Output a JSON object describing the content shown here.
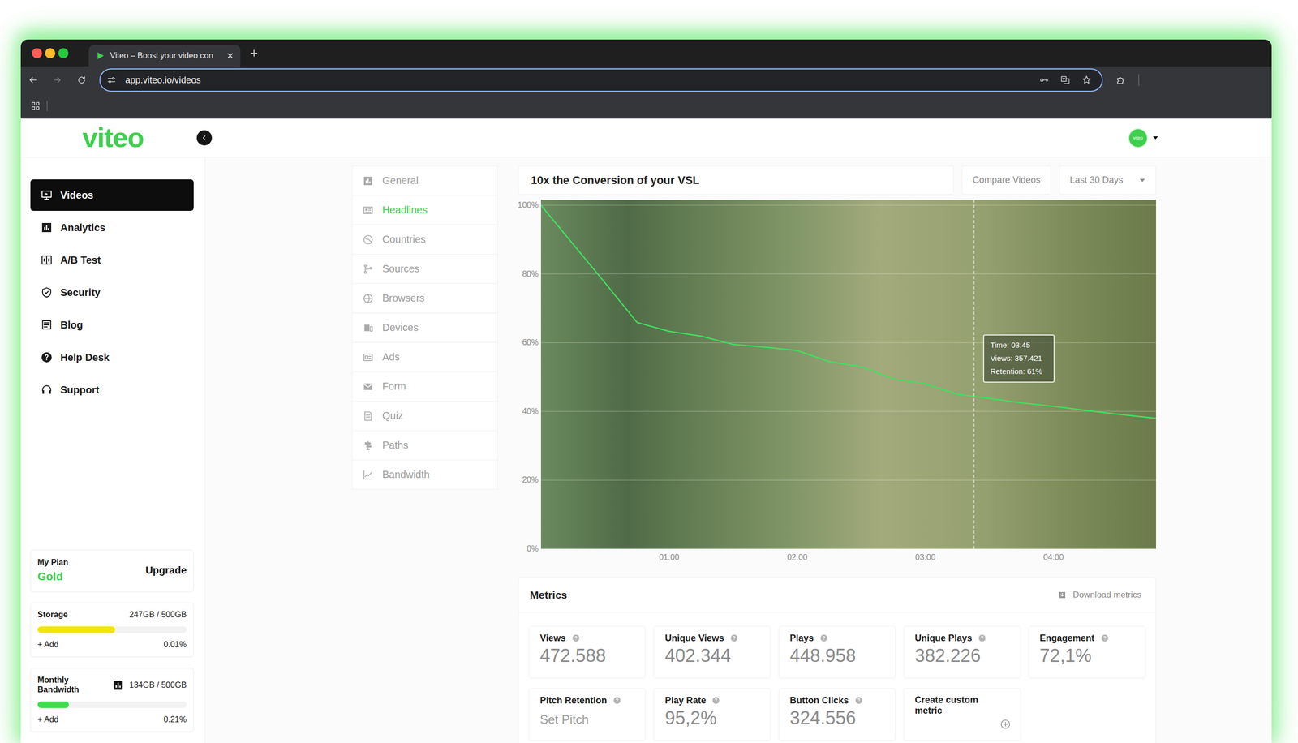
{
  "browser": {
    "tab_title": "Viteo – Boost your video con",
    "url": "app.viteo.io/videos"
  },
  "header": {
    "logo": "viteo",
    "avatar": "viteo"
  },
  "sidebar": {
    "items": [
      {
        "label": "Videos",
        "selected": true
      },
      {
        "label": "Analytics",
        "selected": false
      },
      {
        "label": "A/B Test",
        "selected": false
      },
      {
        "label": "Security",
        "selected": false
      },
      {
        "label": "Blog",
        "selected": false
      },
      {
        "label": "Help Desk",
        "selected": false
      },
      {
        "label": "Support",
        "selected": false
      }
    ],
    "plan": {
      "label": "My Plan",
      "name": "Gold",
      "action": "Upgrade"
    },
    "usage": [
      {
        "kind": "storage",
        "label": "Storage",
        "reading": "247GB / 500GB",
        "level": 0.52,
        "color": "#f2e600",
        "action": "+ Add",
        "percent": "0.01%"
      },
      {
        "kind": "bandwidth",
        "label": "Monthly Bandwidth",
        "reading": "134GB / 500GB",
        "level": 0.21,
        "color": "#3ddc4f",
        "action": "+ Add",
        "percent": "0.21%"
      }
    ]
  },
  "report_menu": {
    "items": [
      {
        "label": "General",
        "selected": false
      },
      {
        "label": "Headlines",
        "selected": true
      },
      {
        "label": "Countries",
        "selected": false
      },
      {
        "label": "Sources",
        "selected": false
      },
      {
        "label": "Browsers",
        "selected": false
      },
      {
        "label": "Devices",
        "selected": false
      },
      {
        "label": "Ads",
        "selected": false
      },
      {
        "label": "Form",
        "selected": false
      },
      {
        "label": "Quiz",
        "selected": false
      },
      {
        "label": "Paths",
        "selected": false
      },
      {
        "label": "Bandwidth",
        "selected": false
      }
    ]
  },
  "chart": {
    "title": "10x the Conversion of your VSL",
    "compare_button": "Compare Videos",
    "range": "Last 30 Days",
    "y_ticks": [
      {
        "label": "100%",
        "value": 100
      },
      {
        "label": "80%",
        "value": 80
      },
      {
        "label": "60%",
        "value": 60
      },
      {
        "label": "40%",
        "value": 40
      },
      {
        "label": "20%",
        "value": 20
      },
      {
        "label": "0%",
        "value": 0
      }
    ],
    "x_ticks": [
      {
        "label": "01:00",
        "seconds": 60
      },
      {
        "label": "02:00",
        "seconds": 120
      },
      {
        "label": "03:00",
        "seconds": 180
      },
      {
        "label": "04:00",
        "seconds": 240
      }
    ],
    "retention": {
      "seconds": [
        0,
        15,
        30,
        45,
        60,
        75,
        90,
        105,
        120,
        135,
        150,
        165,
        180,
        195,
        210,
        225,
        240,
        255,
        270,
        285,
        288
      ],
      "values": [
        100,
        88.7,
        77.4,
        65.9,
        63.3,
        61.9,
        59.5,
        58.7,
        57.7,
        54.5,
        53,
        49.5,
        48,
        45,
        43.8,
        42.5,
        41.5,
        40.3,
        39.2,
        38.2,
        38
      ]
    },
    "tooltip": [
      "Time: 03:45",
      "Views: 357.421",
      "Retention: 61%"
    ]
  },
  "metrics": {
    "title": "Metrics",
    "download": "Download metrics",
    "cards": [
      {
        "kind": "stat",
        "label": "Views",
        "value": "472.588"
      },
      {
        "kind": "stat",
        "label": "Unique Views",
        "value": "402.344"
      },
      {
        "kind": "stat",
        "label": "Plays",
        "value": "448.958"
      },
      {
        "kind": "stat",
        "label": "Unique Plays",
        "value": "382.226"
      },
      {
        "kind": "stat",
        "label": "Engagement",
        "value": "72,1%"
      },
      {
        "kind": "setup",
        "label": "Pitch Retention",
        "value": "Set Pitch"
      },
      {
        "kind": "stat",
        "label": "Play Rate",
        "value": "95,2%"
      },
      {
        "kind": "stat",
        "label": "Button Clicks",
        "value": "324.556"
      },
      {
        "kind": "create",
        "label": "Create custom metric",
        "value": ""
      }
    ]
  }
}
